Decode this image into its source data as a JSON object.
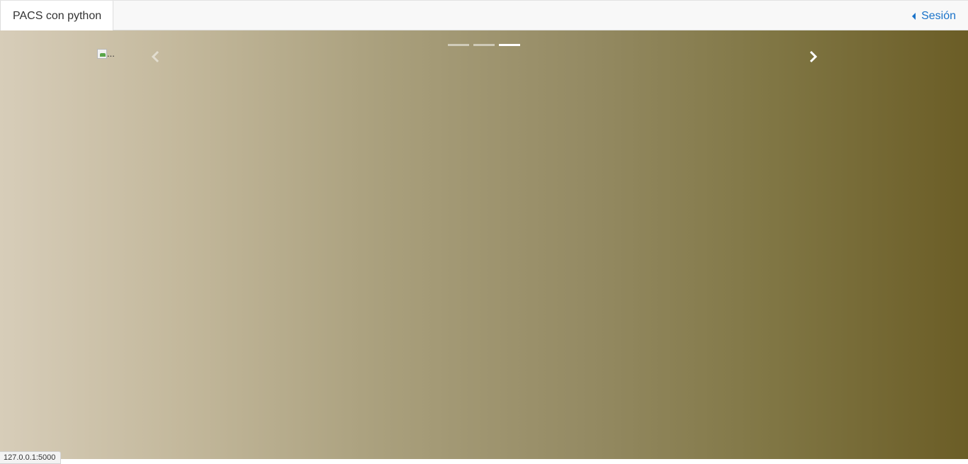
{
  "navbar": {
    "brand": "PACS con python",
    "session_label": "Sesión"
  },
  "carousel": {
    "indicators": [
      {
        "active": false
      },
      {
        "active": false
      },
      {
        "active": true
      }
    ],
    "image_alt": "...",
    "prev_icon": "chevron-left-icon",
    "next_icon": "chevron-right-icon",
    "gradient_colors": [
      "#d7cdb9",
      "#c4b99d",
      "#a99f7c",
      "#958b64",
      "#807644",
      "#6b5d26"
    ]
  },
  "status_bar": {
    "url": "127.0.0.1:5000"
  }
}
